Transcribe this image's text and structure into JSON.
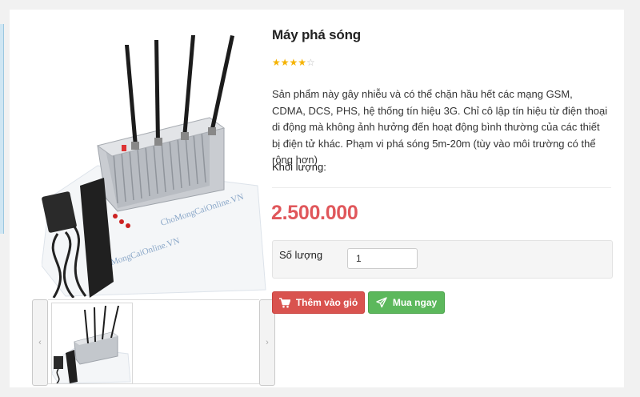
{
  "product": {
    "title": "Máy phá sóng",
    "rating": 4,
    "rating_max": 5,
    "stars_filled": "★★★★",
    "stars_empty": "☆",
    "description": "Sản phẩm này gây nhiễu và có thể chặn hầu hết các mạng GSM, CDMA, DCS, PHS, hệ thống tín hiệu 3G. Chỉ cô lập tín hiệu từ điện thoại di động mà không ảnh hưởng đến hoạt động bình thường của các thiết bị điện tử khác. Phạm vi phá sóng 5m-20m (tùy vào môi trường có thể rộng hơn)",
    "weight_label": "Khối lượng:",
    "price": "2.500.000"
  },
  "quantity": {
    "label": "Số lượng",
    "value": "1"
  },
  "buttons": {
    "add_to_cart": "Thêm vào giỏ",
    "buy_now": "Mua ngay"
  },
  "gallery": {
    "prev": "‹",
    "next": "›",
    "watermark": "ChoMongCaiOnline.VN"
  },
  "colors": {
    "price": "#e0575b",
    "cart_button": "#d9534f",
    "buy_button": "#5cb85c",
    "star": "#f5b301"
  },
  "icons": {
    "cart": "cart-icon",
    "buy": "paper-plane-icon"
  }
}
